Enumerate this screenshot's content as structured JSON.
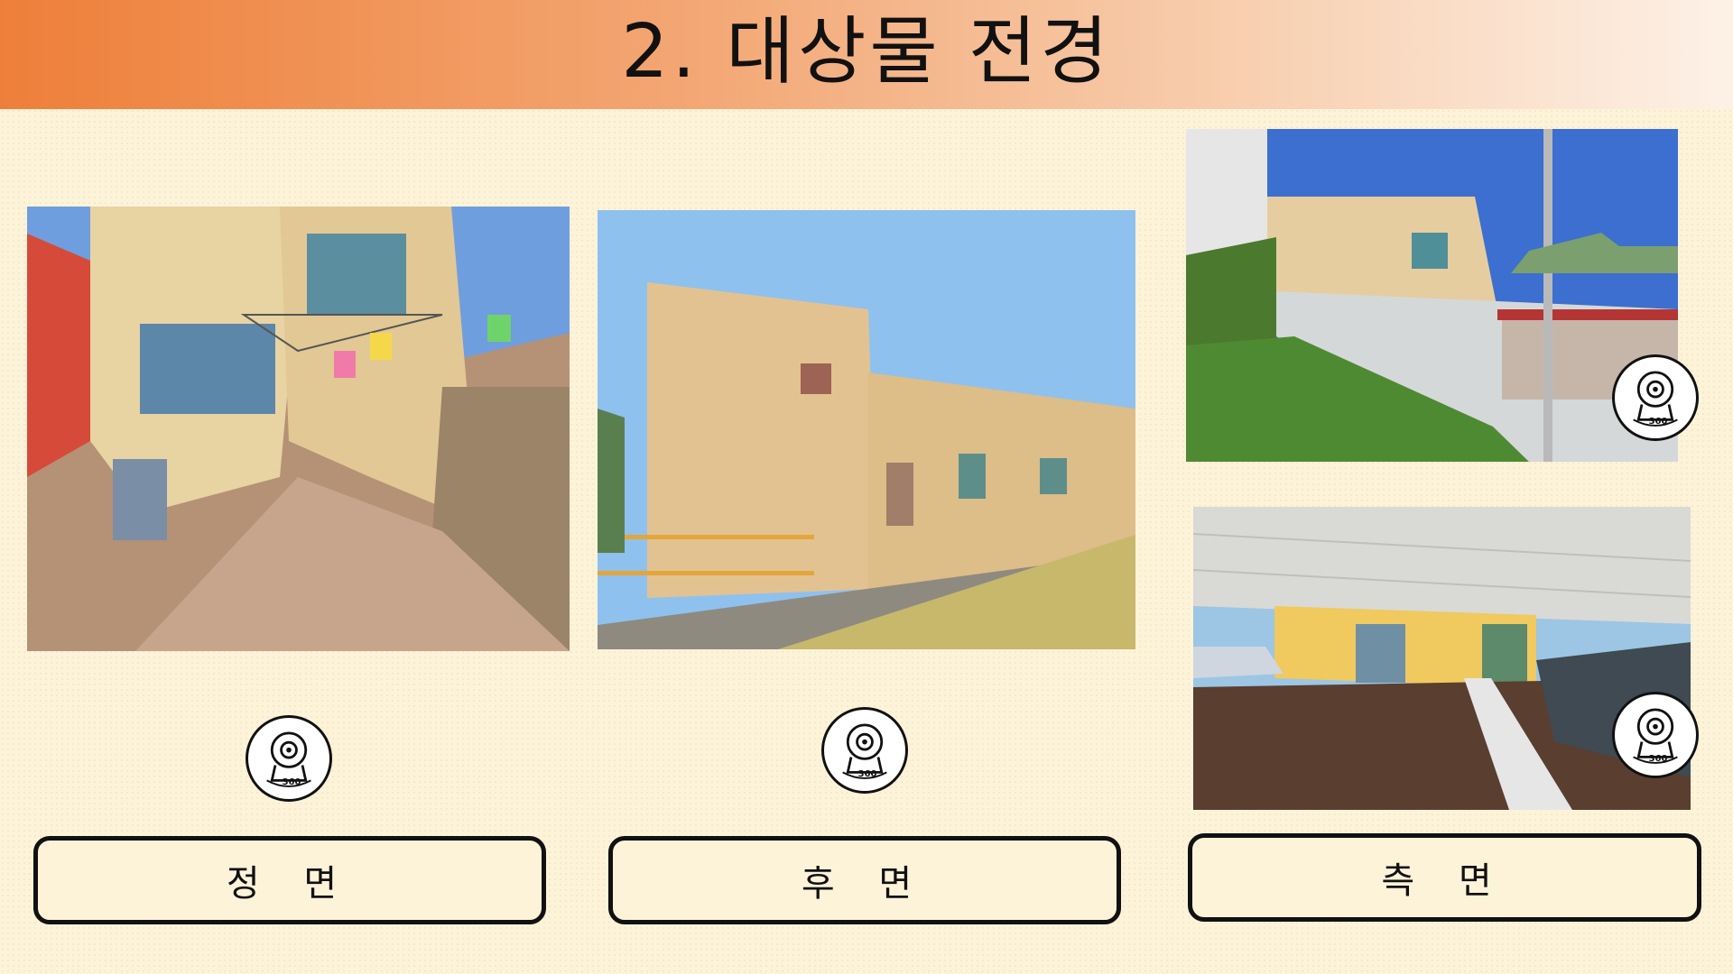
{
  "page": {
    "title": "2. 대상물 전경",
    "colors": {
      "header_start": "#ee7f3a",
      "header_end": "#fdf1e7",
      "background": "#fdf3d9"
    }
  },
  "panels": [
    {
      "id": "front",
      "label": "정 면",
      "camera_icon": "camera-360-icon",
      "camera_text": "360"
    },
    {
      "id": "rear",
      "label": "후 면",
      "camera_icon": "camera-360-icon",
      "camera_text": "360"
    },
    {
      "id": "side",
      "label": "측 면",
      "camera_icon": "camera-360-icon",
      "camera_text": "360"
    }
  ],
  "side_views": [
    {
      "camera_icon": "camera-360-icon",
      "camera_text": "360"
    },
    {
      "camera_icon": "camera-360-icon",
      "camera_text": "360"
    }
  ]
}
